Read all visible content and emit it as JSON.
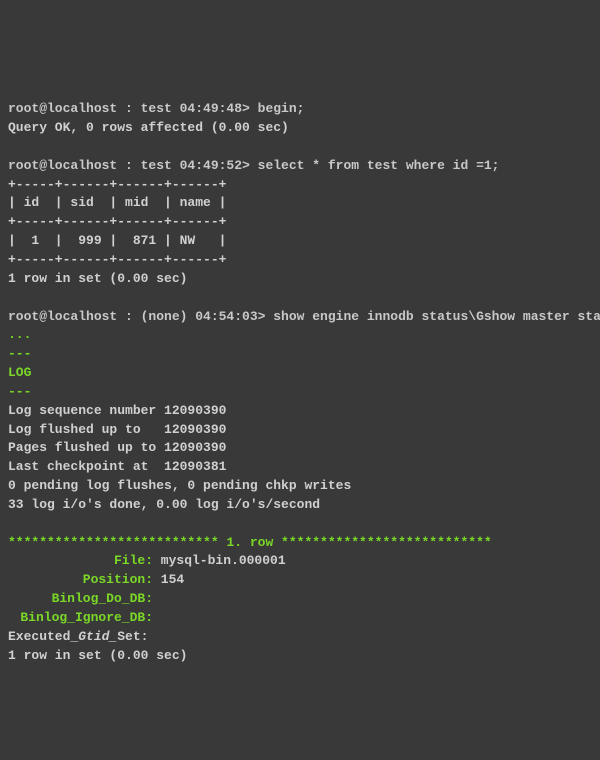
{
  "line1_prompt": "root@localhost : test 04:49:48> ",
  "line1_cmd": "begin;",
  "line2": "Query OK, 0 rows affected (0.00 sec)",
  "blank": " ",
  "line3_prompt": "root@localhost : test 04:49:52> ",
  "line3_cmd": "select * from test where id =1;",
  "tbl_border": "+-----+------+------+------+",
  "tbl_header": "| id  | sid  | mid  | name |",
  "tbl_row": "|  1  |  999 |  871 | NW   |",
  "line_rows": "1 row in set (0.00 sec)",
  "line4_prompt": "root@localhost : (none) 04:54:03> ",
  "line4_cmd": "show engine innodb status\\Gshow master status\\G",
  "dots1": "...",
  "dash": "---",
  "log_header": "LOG",
  "log1": "Log sequence number 12090390",
  "log2": "Log flushed up to   12090390",
  "log3": "Pages flushed up to 12090390",
  "log4": "Last checkpoint at  12090381",
  "log5": "0 pending log flushes, 0 pending chkp writes",
  "log6": "33 log i/o's done, 0.00 log i/o's/second",
  "rowsep": "*************************** 1. row ***************************",
  "r_file_label": "File:",
  "r_file_val": " mysql-bin.000001",
  "r_pos_label": "Position:",
  "r_pos_val": " 154",
  "r_dodb_label": "Binlog_Do_DB:",
  "r_dodb_val": "",
  "r_igndb_label": "Binlog_Ignore_DB:",
  "r_igndb_val": "",
  "exec_part1": "Executed_",
  "exec_part2": "Gtid_",
  "exec_part3": "Set:",
  "line_rows2": "1 row in set (0.00 sec)"
}
